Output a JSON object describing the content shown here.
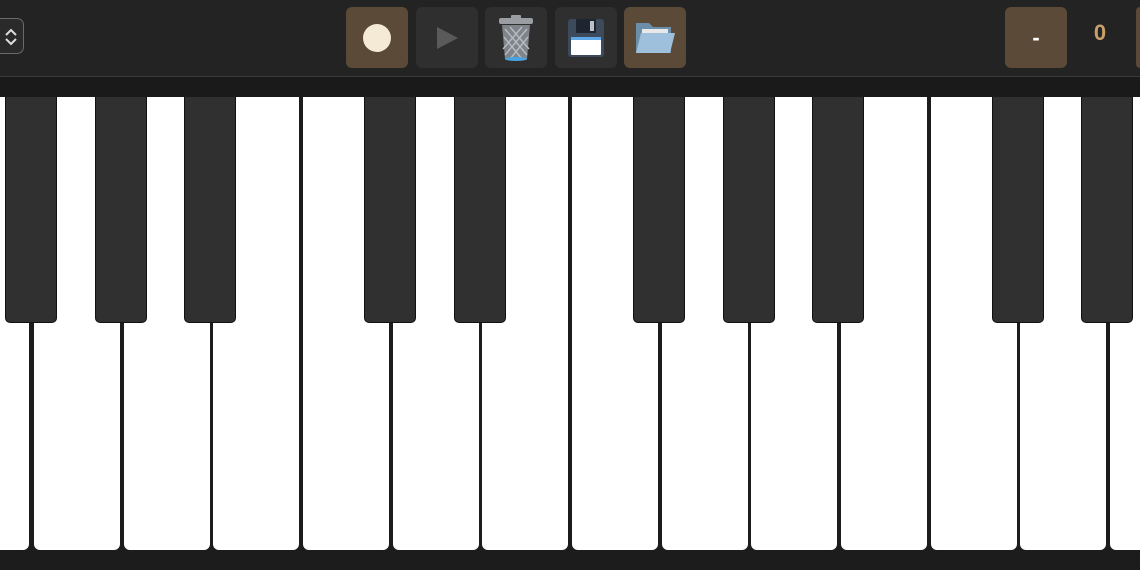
{
  "toolbar": {
    "buttons": [
      {
        "name": "record-button",
        "icon": "record-icon",
        "active": true
      },
      {
        "name": "play-button",
        "icon": "play-icon",
        "active": false
      },
      {
        "name": "clear-button",
        "icon": "trash-icon",
        "active": false
      },
      {
        "name": "save-button",
        "icon": "floppy-disk-icon",
        "active": false
      },
      {
        "name": "open-button",
        "icon": "folder-icon",
        "active": true
      }
    ],
    "transpose_down_label": "-",
    "transpose_value": "0"
  },
  "keyboard": {
    "white_key_count": 13,
    "black_key_count": 10
  },
  "colors": {
    "toolbar_bg": "#232323",
    "button_bg": "#2f2f2f",
    "button_active_bg": "#5b4a37",
    "accent_text": "#c9a06a",
    "black_key": "#303030",
    "white_key": "#ffffff"
  }
}
